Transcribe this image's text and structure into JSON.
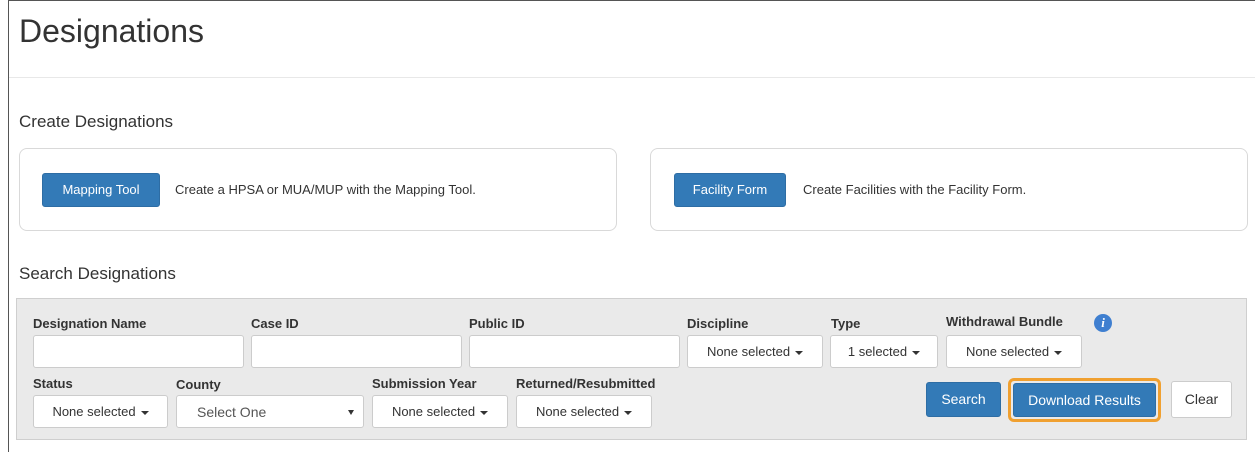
{
  "page": {
    "title": "Designations"
  },
  "create": {
    "heading": "Create Designations",
    "mapping": {
      "button": "Mapping Tool",
      "text": "Create a HPSA or MUA/MUP with the Mapping Tool."
    },
    "facility": {
      "button": "Facility Form",
      "text": "Create Facilities with the Facility Form."
    }
  },
  "search": {
    "heading": "Search Designations",
    "fields": {
      "designation_name": {
        "label": "Designation Name",
        "value": ""
      },
      "case_id": {
        "label": "Case ID",
        "value": ""
      },
      "public_id": {
        "label": "Public ID",
        "value": ""
      },
      "discipline": {
        "label": "Discipline",
        "value": "None selected"
      },
      "type": {
        "label": "Type",
        "value": "1 selected"
      },
      "withdrawal_bundle": {
        "label": "Withdrawal Bundle",
        "value": "None selected",
        "info_icon": "i"
      },
      "status": {
        "label": "Status",
        "value": "None selected"
      },
      "county": {
        "label": "County",
        "value": "Select One"
      },
      "submission_year": {
        "label": "Submission Year",
        "value": "None selected"
      },
      "returned_resubmitted": {
        "label": "Returned/Resubmitted",
        "value": "None selected"
      }
    },
    "buttons": {
      "search": "Search",
      "download": "Download Results",
      "clear": "Clear"
    }
  },
  "colors": {
    "primary": "#337ab7",
    "highlight": "#f0a030",
    "panel": "#eaeaea"
  }
}
